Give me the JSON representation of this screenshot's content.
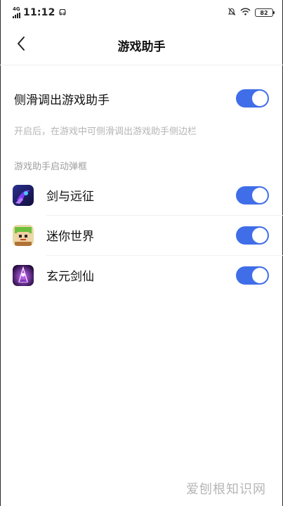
{
  "accent_color": "#3f6ee8",
  "status_bar": {
    "network_tag": "4G",
    "time": "11:12",
    "car_icon": "car-icon",
    "mute_icon": "bell-off-icon",
    "wifi_icon": "wifi-icon",
    "battery_level": "82"
  },
  "header": {
    "title": "游戏助手",
    "back_icon": "chevron-left-icon"
  },
  "main_setting": {
    "label": "侧滑调出游戏助手",
    "enabled": true,
    "description": "开启后，在游戏中可侧滑调出游戏助手侧边栏"
  },
  "section": {
    "title": "游戏助手启动弹框"
  },
  "apps": [
    {
      "name": "剑与远征",
      "enabled": true,
      "icon": "afk-arena-icon"
    },
    {
      "name": "迷你世界",
      "enabled": true,
      "icon": "mini-world-icon"
    },
    {
      "name": "玄元剑仙",
      "enabled": true,
      "icon": "xuanyuan-jianxian-icon"
    }
  ],
  "watermark": "爱刨根知识网"
}
